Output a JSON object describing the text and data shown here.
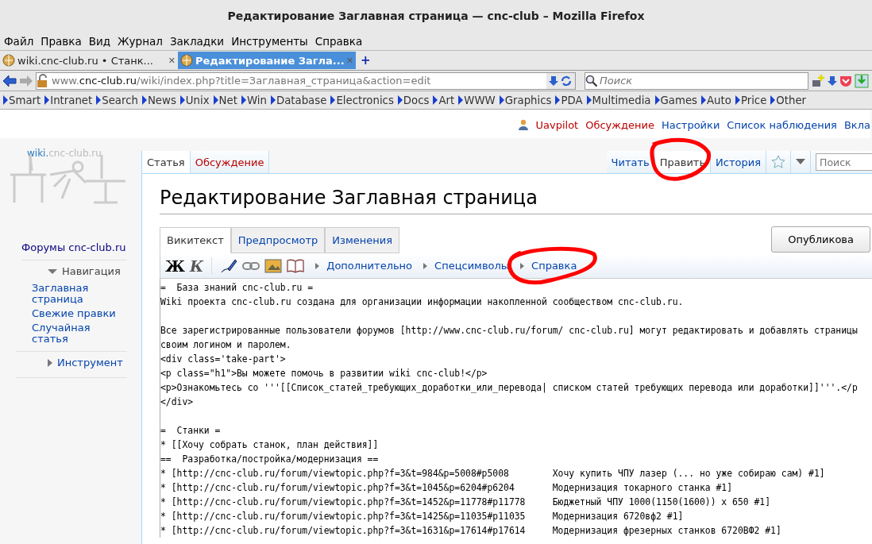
{
  "window": {
    "title": "Редактирование Заглавная страница — cnc-club – Mozilla Firefox"
  },
  "menu": [
    "Файл",
    "Правка",
    "Вид",
    "Журнал",
    "Закладки",
    "Инструменты",
    "Справка"
  ],
  "tabs": [
    {
      "label": "wiki.cnc-club.ru • Станк...",
      "selected": false
    },
    {
      "label": "Редактирование Загла...",
      "selected": true
    }
  ],
  "tab_close": "✕",
  "new_tab": "+",
  "address": {
    "prefix": "www.",
    "host": "cnc-club.ru",
    "path": "/wiki/index.php?title=Заглавная_страница&action=edit"
  },
  "search": {
    "placeholder": "Поиск"
  },
  "bookmarks": [
    "Smart",
    "Intranet",
    "Search",
    "News",
    "Unix",
    "Net",
    "Win",
    "Database",
    "Electronics",
    "Docs",
    "Art",
    "WWW",
    "Graphics",
    "PDA",
    "Multimedia",
    "Games",
    "Auto",
    "Price",
    "Other"
  ],
  "personal": [
    {
      "label": "Uavpilot",
      "kind": "user",
      "missing": true
    },
    {
      "label": "Обсуждение",
      "kind": "link",
      "missing": true
    },
    {
      "label": "Настройки",
      "kind": "link",
      "missing": false
    },
    {
      "label": "Список наблюдения",
      "kind": "link",
      "missing": false
    },
    {
      "label": "Вкла",
      "kind": "link",
      "missing": false
    }
  ],
  "logo": {
    "accent": "wiki.",
    "rest": "cnc-club.ru"
  },
  "sidebar": {
    "top_link": "Форумы cnc-club.ru",
    "sections": [
      {
        "title": "Навигация",
        "expanded": true,
        "items": [
          "Заглавная страница",
          "Свежие правки",
          "Случайная статья"
        ]
      },
      {
        "title": "Инструмент",
        "expanded": false
      }
    ]
  },
  "namespaces": [
    {
      "label": "Статья",
      "selected": true,
      "missing": false
    },
    {
      "label": "Обсуждение",
      "selected": false,
      "missing": true
    }
  ],
  "views": [
    {
      "label": "Читать",
      "selected": false
    },
    {
      "label": "Править",
      "selected": true
    },
    {
      "label": "История",
      "selected": false
    }
  ],
  "page_search": {
    "placeholder": "Поиск"
  },
  "heading": "Редактирование Заглавная страница",
  "edit_tabs": [
    {
      "label": "Викитекст",
      "selected": true
    },
    {
      "label": "Предпросмотр",
      "selected": false
    },
    {
      "label": "Изменения",
      "selected": false
    }
  ],
  "publish_button": "Опубликова",
  "toolbar": {
    "bold": "Ж",
    "italic": "К",
    "groups": [
      "Дополнительно",
      "Спецсимволы",
      "Справка"
    ]
  },
  "editor_paragraphs": [
    [
      "=  База знаний cnc-club.ru =",
      "Wiki проекта cnc-club.ru создана для организации информации накопленной сообществом cnc-club.ru."
    ],
    [
      "Все зарегистрированные пользователи форумов [http://www.cnc-club.ru/forum/ cnc-club.ru] могут редактировать и добавлять страницы",
      "своим логином и паролем.",
      "<div class='take-part'>",
      "<p class=\"h1\">Вы можете помочь в развитии wiki cnc-club!</p>",
      "<p>Ознакомьтесь со '''[[Список_статей_требующих_доработки_или_перевода| списком статей требующих перевода или доработки]]'''.</p",
      "</div>"
    ],
    [
      "=  Станки =",
      "* [[Хочу собрать станок, план действия]]",
      "==  Разработка/постройка/модернизация ==",
      "* [http://cnc-club.ru/forum/viewtopic.php?f=3&t=984&p=5008#p5008        Хочу купить ЧПУ лазер (... но уже собираю сам) #1]",
      "* [http://cnc-club.ru/forum/viewtopic.php?f=3&t=1045&p=6204#p6204       Модернизация токарного станка #1]",
      "* [http://cnc-club.ru/forum/viewtopic.php?f=3&t=1452&p=11778#p11778     Бюджетный ЧПУ 1000(1150(1600)) x 650 #1]",
      "* [http://cnc-club.ru/forum/viewtopic.php?f=3&t=1425&p=11035#p11035     Модернизация 6720вф2 #1]",
      "* [http://cnc-club.ru/forum/viewtopic.php?f=3&t=1631&p=17614#p17614     Модернизация фрезерных станков 6720ВФ2 #1]"
    ]
  ]
}
